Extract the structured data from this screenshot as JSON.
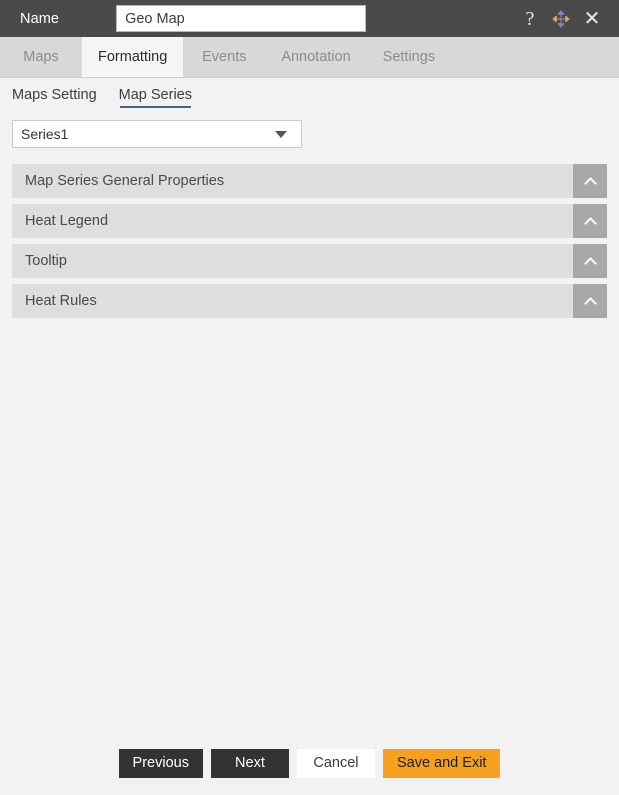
{
  "titlebar": {
    "name_label": "Name",
    "name_value": "Geo Map",
    "name_placeholder": "Geo Map",
    "help_icon": "question-mark-icon",
    "move_icon": "move-arrows-icon",
    "close_icon": "close-icon",
    "close_glyph": "✕",
    "help_glyph": "?",
    "background_color": "#4a4a4a"
  },
  "tabs": [
    {
      "label": "Maps",
      "active": false
    },
    {
      "label": "Formatting",
      "active": true
    },
    {
      "label": "Events",
      "active": false
    },
    {
      "label": "Annotation",
      "active": false
    },
    {
      "label": "Settings",
      "active": false
    }
  ],
  "subnav": [
    {
      "label": "Maps Setting",
      "active": false
    },
    {
      "label": "Map Series",
      "active": true
    }
  ],
  "series_select": {
    "value": "Series1",
    "options": [
      "Series1"
    ],
    "caret_icon": "chevron-down-icon"
  },
  "sections": [
    {
      "label": "Map Series General Properties",
      "toggle_icon": "chevron-up-icon",
      "expanded": false
    },
    {
      "label": "Heat Legend",
      "toggle_icon": "chevron-up-icon",
      "expanded": false
    },
    {
      "label": "Tooltip",
      "toggle_icon": "chevron-up-icon",
      "expanded": false
    },
    {
      "label": "Heat Rules",
      "toggle_icon": "chevron-up-icon",
      "expanded": false
    }
  ],
  "footer": {
    "previous_label": "Previous",
    "next_label": "Next",
    "cancel_label": "Cancel",
    "save_label": "Save and Exit"
  },
  "colors": {
    "accent": "#f5a01e",
    "dark_button": "#333333",
    "titlebar": "#4a4a4a",
    "tabbar": "#d8d8d8",
    "active_tab": "#f6f6f6",
    "section_header": "#dedede",
    "section_toggle": "#a8a8a8",
    "underline": "#4b5e86",
    "page_background": "#f2f2f2"
  }
}
